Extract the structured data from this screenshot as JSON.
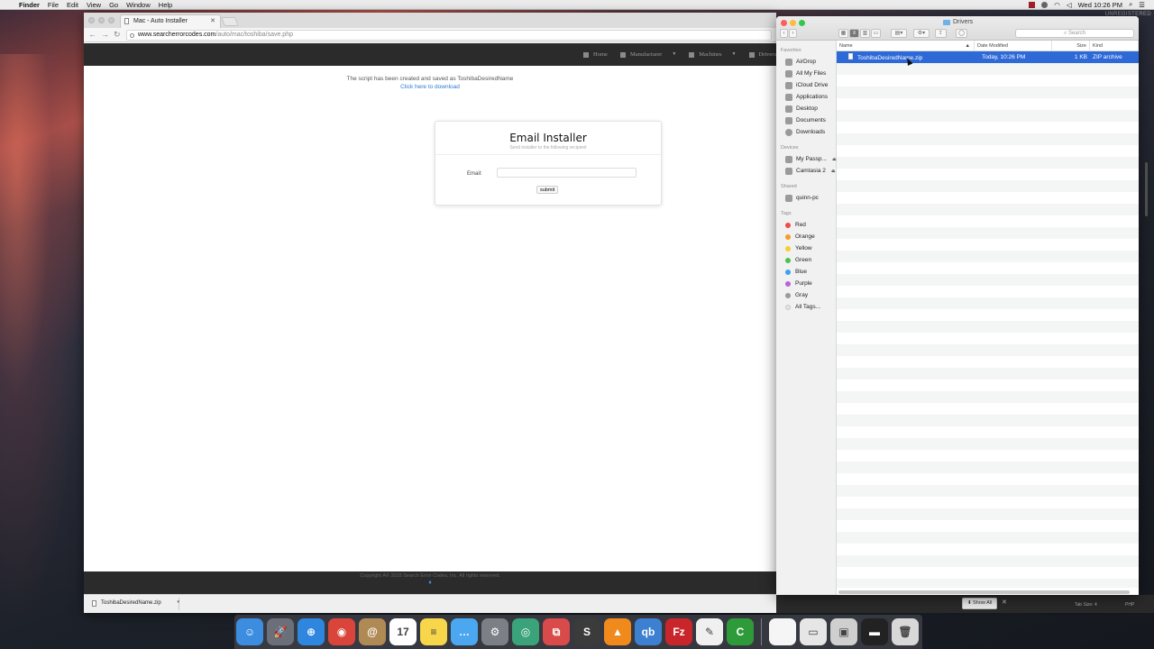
{
  "menubar": {
    "app_name": "Finder",
    "menus": [
      "File",
      "Edit",
      "View",
      "Go",
      "Window",
      "Help"
    ],
    "clock": "Wed 10:26 PM",
    "unregistered": "UNREGISTERED"
  },
  "browser": {
    "tab_title": "Mac - Auto Installer",
    "url_host": "www.searcherrorcodes.com",
    "url_path": "/auto/mac/toshiba/save.php",
    "site": {
      "nav": [
        "Home",
        "Manufacturer",
        "Machines",
        "Drivers"
      ],
      "notice": "The script has been created and saved as ToshibaDesiredName",
      "download_link": "Click here to download",
      "card_title": "Email Installer",
      "card_subtitle": "Send installer to the following recipient",
      "email_label": "Email:",
      "email_value": "",
      "submit_label": "submit",
      "footer": "Copyright Â© 2015 Search Error Codes, Inc. All rights reserved."
    },
    "download_shelf": {
      "filename": "ToshibaDesiredName.zip",
      "show_all": "Show All"
    }
  },
  "finder": {
    "title": "Drivers",
    "search_placeholder": "Search",
    "sidebar": {
      "favorites_header": "Favorites",
      "favorites": [
        "AirDrop",
        "All My Files",
        "iCloud Drive",
        "Applications",
        "Desktop",
        "Documents",
        "Downloads"
      ],
      "devices_header": "Devices",
      "devices": [
        "My Passp...",
        "Camtasia 2"
      ],
      "shared_header": "Shared",
      "shared": [
        "quinn-pc"
      ],
      "tags_header": "Tags",
      "tags": [
        {
          "name": "Red",
          "color": "#f04b4b"
        },
        {
          "name": "Orange",
          "color": "#f59a2f"
        },
        {
          "name": "Yellow",
          "color": "#f5cf2f"
        },
        {
          "name": "Green",
          "color": "#4cc24c"
        },
        {
          "name": "Blue",
          "color": "#3ba1f0"
        },
        {
          "name": "Purple",
          "color": "#b565d9"
        },
        {
          "name": "Gray",
          "color": "#9a9a9a"
        }
      ],
      "all_tags": "All Tags..."
    },
    "columns": {
      "name": "Name",
      "date": "Date Modified",
      "size": "Size",
      "kind": "Kind"
    },
    "files": [
      {
        "name": "ToshibaDesiredName.zip",
        "date": "Today, 10:26 PM",
        "size": "1 KB",
        "kind": "ZIP archive"
      }
    ]
  },
  "editor_status": {
    "tab_size": "Tab Size: 4",
    "syntax": "PHP"
  },
  "dock": {
    "apps": [
      {
        "name": "finder-icon",
        "color": "#3c8de0",
        "glyph": "☺"
      },
      {
        "name": "launchpad-icon",
        "color": "#6b6f7a",
        "glyph": "🚀"
      },
      {
        "name": "safari-icon",
        "color": "#2e86de",
        "glyph": "⊕"
      },
      {
        "name": "chrome-icon",
        "color": "#d9453a",
        "glyph": "◉"
      },
      {
        "name": "contacts-icon",
        "color": "#b08a55",
        "glyph": "@"
      },
      {
        "name": "calendar-icon",
        "color": "#ffffff",
        "glyph": "17"
      },
      {
        "name": "notes-icon",
        "color": "#f7d64a",
        "glyph": "≡"
      },
      {
        "name": "messages-icon",
        "color": "#4aa7f0",
        "glyph": "…"
      },
      {
        "name": "system-preferences-icon",
        "color": "#7b7f86",
        "glyph": "⚙"
      },
      {
        "name": "network-utility-icon",
        "color": "#3aa37a",
        "glyph": "◎"
      },
      {
        "name": "screen-sharing-icon",
        "color": "#d94a4a",
        "glyph": "⧉"
      },
      {
        "name": "sublime-text-icon",
        "color": "#3b3b3b",
        "glyph": "S"
      },
      {
        "name": "vlc-icon",
        "color": "#f08a1c",
        "glyph": "▲"
      },
      {
        "name": "qbittorrent-icon",
        "color": "#3d7fd0",
        "glyph": "qb"
      },
      {
        "name": "filezilla-icon",
        "color": "#c8262b",
        "glyph": "Fz"
      },
      {
        "name": "textedit-icon",
        "color": "#f0f0f0",
        "glyph": "✎"
      },
      {
        "name": "camtasia-icon",
        "color": "#2f9a3a",
        "glyph": "C"
      }
    ],
    "stack_items": [
      {
        "name": "document-stack-icon",
        "color": "#f5f5f5",
        "glyph": ""
      },
      {
        "name": "screenshot-stack-icon",
        "color": "#e6e6e6",
        "glyph": "▭"
      },
      {
        "name": "media-stack-icon",
        "color": "#cfcfcf",
        "glyph": "▣"
      },
      {
        "name": "terminal-stack-icon",
        "color": "#222222",
        "glyph": "▬"
      },
      {
        "name": "trash-icon",
        "color": "#d8d8d8",
        "glyph": "🗑"
      }
    ]
  }
}
